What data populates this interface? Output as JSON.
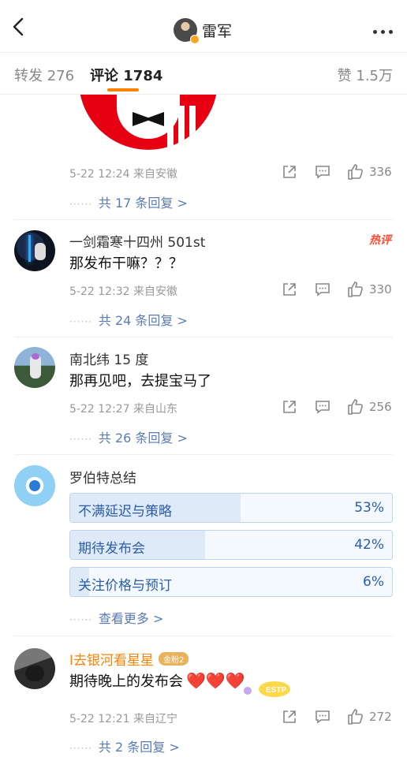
{
  "header": {
    "title": "雷军",
    "back_icon": "chevron-left-icon",
    "more_icon": "more-horizontal-icon"
  },
  "tabs": [
    {
      "label": "转发 276"
    },
    {
      "label": "评论 1784"
    },
    {
      "label": "赞 1.5万"
    }
  ],
  "comments": [
    {
      "meta": "5-22 12:24  来自安徽",
      "likes": "336",
      "reply_text": "共 17 条回复 >"
    },
    {
      "username": "一剑霜寒十四州 501st",
      "badge": "热评",
      "text": "那发布干嘛？？？",
      "meta": "5-22 12:32  来自安徽",
      "likes": "330",
      "reply_text": "共 24 条回复 >"
    },
    {
      "username": "南北纬 15 度",
      "text": "那再见吧，去提宝马了",
      "meta": "5-22 12:27  来自山东",
      "likes": "256",
      "reply_text": "共 26 条回复 >"
    },
    {
      "username": "I去银河看星星",
      "fan_badge": "金粉2",
      "text": "期待晚上的发布会",
      "hearts": "❤️❤️❤️",
      "sticker_text": "ESTP",
      "meta": "5-22 12:21  来自辽宁",
      "likes": "272",
      "reply_text": "共 2 条回复 >"
    }
  ],
  "vote": {
    "username": "罗伯特总结",
    "options": [
      {
        "label": "不满延迟与策略",
        "pct": "53%",
        "fraction": 0.53
      },
      {
        "label": "期待发布会",
        "pct": "42%",
        "fraction": 0.42
      },
      {
        "label": "关注价格与预订",
        "pct": "6%",
        "fraction": 0.06
      }
    ],
    "see_more": "查看更多 >"
  },
  "colors": {
    "accent": "#ff8200",
    "link": "#5a7bb5",
    "vote_text": "#2b5da8",
    "hot": "#ff4b33"
  }
}
